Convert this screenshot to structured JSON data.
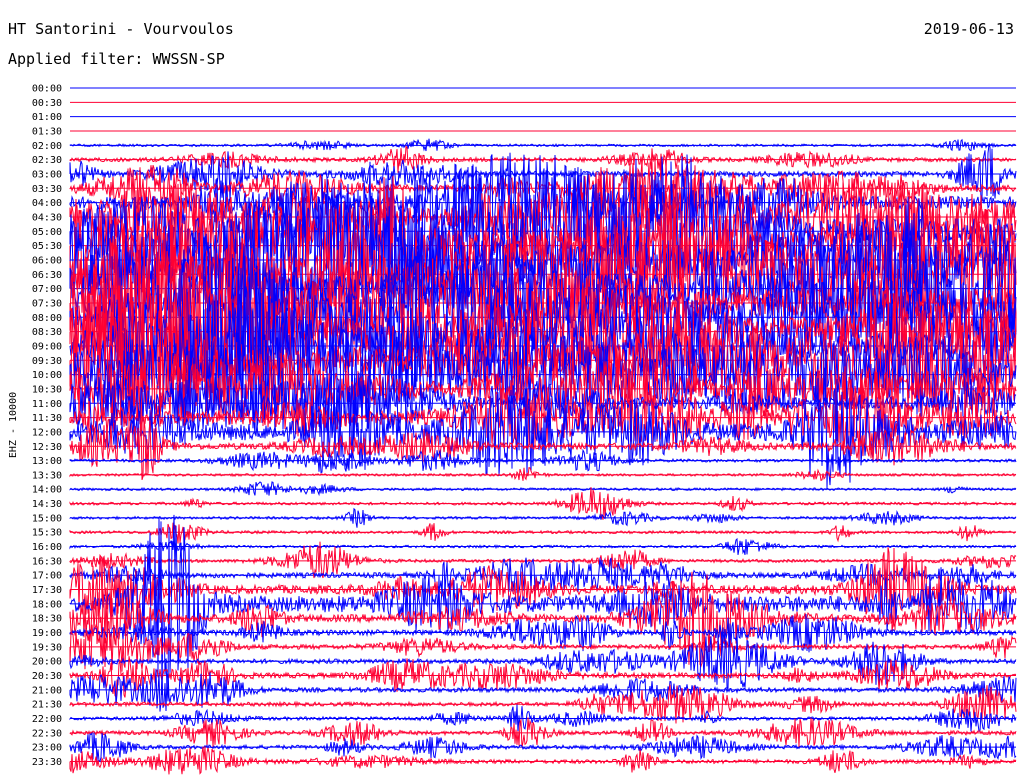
{
  "header": {
    "station": "HT Santorini - Vourvoulos",
    "date": "2019-06-13",
    "filter": "Applied filter: WWSSN-SP"
  },
  "chart_data": {
    "type": "line",
    "title": "HT Santorini - Vourvoulos",
    "ylabel": "EHZ - 10000",
    "trace_colors": [
      "#0000ff",
      "#ff0033"
    ],
    "rows": [
      {
        "time": "00:00",
        "color": "#0000ff",
        "activity": 0.0
      },
      {
        "time": "00:30",
        "color": "#ff0033",
        "activity": 0.0
      },
      {
        "time": "01:00",
        "color": "#0000ff",
        "activity": 0.0
      },
      {
        "time": "01:30",
        "color": "#ff0033",
        "activity": 0.0
      },
      {
        "time": "02:00",
        "color": "#0000ff",
        "activity": 0.05
      },
      {
        "time": "02:30",
        "color": "#ff0033",
        "activity": 0.35
      },
      {
        "time": "03:00",
        "color": "#0000ff",
        "activity": 0.45
      },
      {
        "time": "03:30",
        "color": "#ff0033",
        "activity": 0.55
      },
      {
        "time": "04:00",
        "color": "#0000ff",
        "activity": 0.7
      },
      {
        "time": "04:30",
        "color": "#ff0033",
        "activity": 0.8
      },
      {
        "time": "05:00",
        "color": "#0000ff",
        "activity": 0.95
      },
      {
        "time": "05:30",
        "color": "#ff0033",
        "activity": 1.0
      },
      {
        "time": "06:00",
        "color": "#0000ff",
        "activity": 1.0
      },
      {
        "time": "06:30",
        "color": "#ff0033",
        "activity": 1.0
      },
      {
        "time": "07:00",
        "color": "#0000ff",
        "activity": 1.0
      },
      {
        "time": "07:30",
        "color": "#ff0033",
        "activity": 1.0
      },
      {
        "time": "08:00",
        "color": "#0000ff",
        "activity": 1.0
      },
      {
        "time": "08:30",
        "color": "#ff0033",
        "activity": 1.0
      },
      {
        "time": "09:00",
        "color": "#0000ff",
        "activity": 1.0
      },
      {
        "time": "09:30",
        "color": "#ff0033",
        "activity": 1.0
      },
      {
        "time": "10:00",
        "color": "#0000ff",
        "activity": 0.95
      },
      {
        "time": "10:30",
        "color": "#ff0033",
        "activity": 0.75
      },
      {
        "time": "11:00",
        "color": "#0000ff",
        "activity": 0.7
      },
      {
        "time": "11:30",
        "color": "#ff0033",
        "activity": 0.75
      },
      {
        "time": "12:00",
        "color": "#0000ff",
        "activity": 0.8
      },
      {
        "time": "12:30",
        "color": "#ff0033",
        "activity": 0.5
      },
      {
        "time": "13:00",
        "color": "#0000ff",
        "activity": 0.25
      },
      {
        "time": "13:30",
        "color": "#ff0033",
        "activity": 0.02
      },
      {
        "time": "14:00",
        "color": "#0000ff",
        "activity": 0.12
      },
      {
        "time": "14:30",
        "color": "#ff0033",
        "activity": 0.18
      },
      {
        "time": "15:00",
        "color": "#0000ff",
        "activity": 0.15
      },
      {
        "time": "15:30",
        "color": "#ff0033",
        "activity": 0.2
      },
      {
        "time": "16:00",
        "color": "#0000ff",
        "activity": 0.08
      },
      {
        "time": "16:30",
        "color": "#ff0033",
        "activity": 0.25
      },
      {
        "time": "17:00",
        "color": "#0000ff",
        "activity": 0.45
      },
      {
        "time": "17:30",
        "color": "#ff0033",
        "activity": 0.6
      },
      {
        "time": "18:00",
        "color": "#0000ff",
        "activity": 0.8
      },
      {
        "time": "18:30",
        "color": "#ff0033",
        "activity": 0.55
      },
      {
        "time": "19:00",
        "color": "#0000ff",
        "activity": 0.45
      },
      {
        "time": "19:30",
        "color": "#ff0033",
        "activity": 0.4
      },
      {
        "time": "20:00",
        "color": "#0000ff",
        "activity": 0.4
      },
      {
        "time": "20:30",
        "color": "#ff0033",
        "activity": 0.45
      },
      {
        "time": "21:00",
        "color": "#0000ff",
        "activity": 0.4
      },
      {
        "time": "21:30",
        "color": "#ff0033",
        "activity": 0.35
      },
      {
        "time": "22:00",
        "color": "#0000ff",
        "activity": 0.3
      },
      {
        "time": "22:30",
        "color": "#ff0033",
        "activity": 0.35
      },
      {
        "time": "23:00",
        "color": "#0000ff",
        "activity": 0.35
      },
      {
        "time": "23:30",
        "color": "#ff0033",
        "activity": 0.35
      }
    ]
  }
}
